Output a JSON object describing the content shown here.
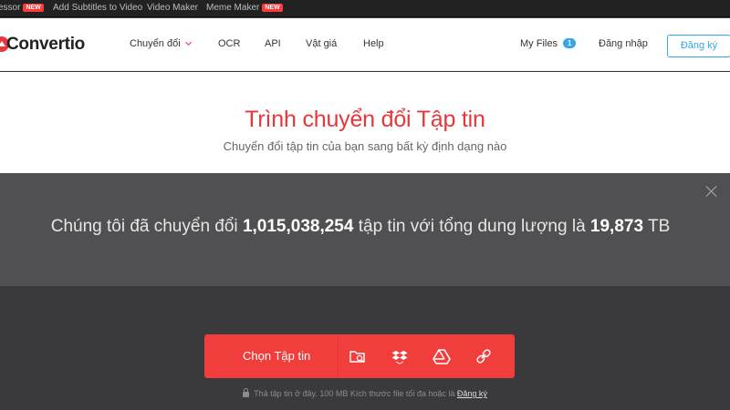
{
  "topbar": {
    "items": [
      {
        "label": "essor",
        "new": true
      },
      {
        "label": "Add Subtitles to Video",
        "new": false
      },
      {
        "label": "Video Maker",
        "new": false
      },
      {
        "label": "Meme Maker",
        "new": true
      }
    ],
    "new_badge": "NEW"
  },
  "header": {
    "logo": "Convertio",
    "nav": {
      "convert": "Chuyển đổi",
      "ocr": "OCR",
      "api": "API",
      "pricing": "Vật giá",
      "help": "Help"
    },
    "my_files": "My Files",
    "my_files_count": "1",
    "login": "Đăng nhập",
    "signup": "Đăng ký"
  },
  "hero": {
    "title": "Trình chuyển đổi Tập tin",
    "subtitle": "Chuyển đổi tập tin của bạn sang bất kỳ định dạng nào"
  },
  "stats": {
    "prefix": "Chúng tôi đã chuyển đổi ",
    "files_count": "1,015,038,254",
    "middle": " tập tin với tổng dung lượng là ",
    "total_size": "19,873",
    "unit": " TB"
  },
  "upload": {
    "choose_label": "Chọn Tập tin",
    "hint": "Thả tập tin ở đây. 100 MB Kích thước file tối đa hoặc là ",
    "hint_link": "Đăng ký"
  },
  "icons": {
    "folder_search": "folder-search-icon",
    "dropbox": "dropbox-icon",
    "google_drive": "google-drive-icon",
    "url_link": "link-icon",
    "close": "close-icon",
    "lock": "lock-icon"
  },
  "colors": {
    "brand_red": "#e8363a",
    "upload_red": "#f23d3d",
    "accent_blue": "#35a6e8",
    "overlay": "#505052"
  }
}
